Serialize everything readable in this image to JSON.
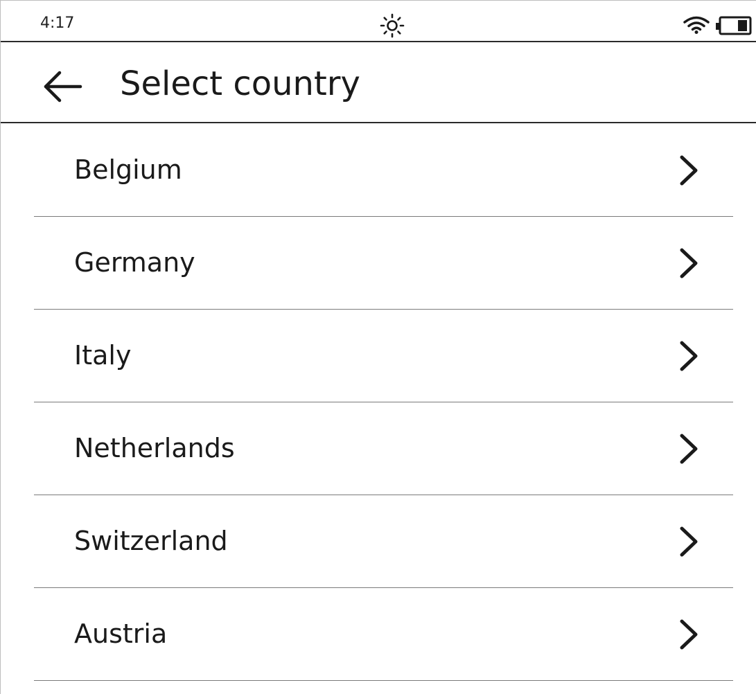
{
  "status_bar": {
    "time": "4:17",
    "frontlight_icon": "sun-icon",
    "wifi_icon": "wifi-icon",
    "battery_icon": "battery-icon"
  },
  "header": {
    "back_icon": "arrow-left-icon",
    "title": "Select country"
  },
  "countries": [
    {
      "label": "Belgium"
    },
    {
      "label": "Germany"
    },
    {
      "label": "Italy"
    },
    {
      "label": "Netherlands"
    },
    {
      "label": "Switzerland"
    },
    {
      "label": "Austria"
    }
  ],
  "chevron_icon": "chevron-right-icon"
}
